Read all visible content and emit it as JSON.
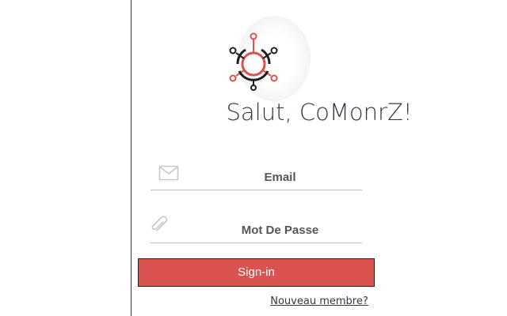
{
  "app": {
    "logo_icon": "network-hub-icon",
    "colors": {
      "accent": "#d9534f",
      "dark": "#1f1f1f",
      "text": "#2f3a48"
    }
  },
  "header": {
    "title": "Salut, CoMonrZ!"
  },
  "form": {
    "email": {
      "icon": "envelope-icon",
      "placeholder": "Email",
      "value": ""
    },
    "password": {
      "icon": "paperclip-icon",
      "placeholder": "Mot De Passe",
      "value": ""
    },
    "submit_label": "Sign-in",
    "register_link": "Nouveau membre?"
  }
}
